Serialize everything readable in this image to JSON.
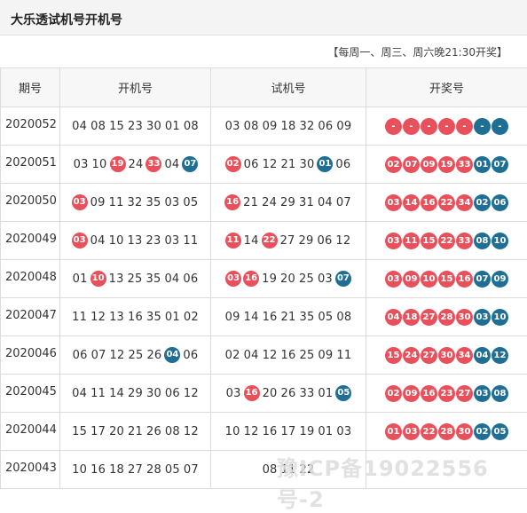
{
  "header": {
    "title": "大乐透试机号开机号"
  },
  "notice": "【每周一、周三、周六晚21:30开奖】",
  "columns": [
    "期号",
    "开机号",
    "试机号",
    "开奖号"
  ],
  "colors": {
    "red": "#e8505b",
    "blue": "#1f6f95"
  },
  "rows": [
    {
      "issue": "2020052",
      "open": [
        {
          "n": "04"
        },
        {
          "n": "08"
        },
        {
          "n": "15"
        },
        {
          "n": "23"
        },
        {
          "n": "30"
        },
        {
          "n": "01"
        },
        {
          "n": "08"
        }
      ],
      "trial": [
        {
          "n": "03"
        },
        {
          "n": "08"
        },
        {
          "n": "09"
        },
        {
          "n": "18"
        },
        {
          "n": "32"
        },
        {
          "n": "06"
        },
        {
          "n": "09"
        }
      ],
      "draw": [
        {
          "n": "-",
          "c": "red"
        },
        {
          "n": "-",
          "c": "red"
        },
        {
          "n": "-",
          "c": "red"
        },
        {
          "n": "-",
          "c": "red"
        },
        {
          "n": "-",
          "c": "red"
        },
        {
          "n": "-",
          "c": "blue"
        },
        {
          "n": "-",
          "c": "blue"
        }
      ]
    },
    {
      "issue": "2020051",
      "open": [
        {
          "n": "03"
        },
        {
          "n": "10"
        },
        {
          "n": "19",
          "c": "red"
        },
        {
          "n": "24"
        },
        {
          "n": "33",
          "c": "red"
        },
        {
          "n": "04"
        },
        {
          "n": "07",
          "c": "blue"
        }
      ],
      "trial": [
        {
          "n": "02",
          "c": "red"
        },
        {
          "n": "06"
        },
        {
          "n": "12"
        },
        {
          "n": "21"
        },
        {
          "n": "30"
        },
        {
          "n": "01",
          "c": "blue"
        },
        {
          "n": "06"
        }
      ],
      "draw": [
        {
          "n": "02",
          "c": "red"
        },
        {
          "n": "07",
          "c": "red"
        },
        {
          "n": "09",
          "c": "red"
        },
        {
          "n": "19",
          "c": "red"
        },
        {
          "n": "33",
          "c": "red"
        },
        {
          "n": "01",
          "c": "blue"
        },
        {
          "n": "07",
          "c": "blue"
        }
      ]
    },
    {
      "issue": "2020050",
      "open": [
        {
          "n": "03",
          "c": "red"
        },
        {
          "n": "09"
        },
        {
          "n": "11"
        },
        {
          "n": "32"
        },
        {
          "n": "35"
        },
        {
          "n": "03"
        },
        {
          "n": "05"
        }
      ],
      "trial": [
        {
          "n": "16",
          "c": "red"
        },
        {
          "n": "21"
        },
        {
          "n": "24"
        },
        {
          "n": "29"
        },
        {
          "n": "31"
        },
        {
          "n": "04"
        },
        {
          "n": "07"
        }
      ],
      "draw": [
        {
          "n": "03",
          "c": "red"
        },
        {
          "n": "14",
          "c": "red"
        },
        {
          "n": "16",
          "c": "red"
        },
        {
          "n": "22",
          "c": "red"
        },
        {
          "n": "34",
          "c": "red"
        },
        {
          "n": "02",
          "c": "blue"
        },
        {
          "n": "06",
          "c": "blue"
        }
      ]
    },
    {
      "issue": "2020049",
      "open": [
        {
          "n": "03",
          "c": "red"
        },
        {
          "n": "04"
        },
        {
          "n": "10"
        },
        {
          "n": "13"
        },
        {
          "n": "23"
        },
        {
          "n": "03"
        },
        {
          "n": "11"
        }
      ],
      "trial": [
        {
          "n": "11",
          "c": "red"
        },
        {
          "n": "14"
        },
        {
          "n": "22",
          "c": "red"
        },
        {
          "n": "27"
        },
        {
          "n": "29"
        },
        {
          "n": "06"
        },
        {
          "n": "12"
        }
      ],
      "draw": [
        {
          "n": "03",
          "c": "red"
        },
        {
          "n": "11",
          "c": "red"
        },
        {
          "n": "15",
          "c": "red"
        },
        {
          "n": "22",
          "c": "red"
        },
        {
          "n": "33",
          "c": "red"
        },
        {
          "n": "08",
          "c": "blue"
        },
        {
          "n": "10",
          "c": "blue"
        }
      ]
    },
    {
      "issue": "2020048",
      "open": [
        {
          "n": "01"
        },
        {
          "n": "10",
          "c": "red"
        },
        {
          "n": "13"
        },
        {
          "n": "25"
        },
        {
          "n": "35"
        },
        {
          "n": "04"
        },
        {
          "n": "06"
        }
      ],
      "trial": [
        {
          "n": "03",
          "c": "red"
        },
        {
          "n": "16",
          "c": "red"
        },
        {
          "n": "19"
        },
        {
          "n": "20"
        },
        {
          "n": "25"
        },
        {
          "n": "03"
        },
        {
          "n": "07",
          "c": "blue"
        }
      ],
      "draw": [
        {
          "n": "03",
          "c": "red"
        },
        {
          "n": "09",
          "c": "red"
        },
        {
          "n": "10",
          "c": "red"
        },
        {
          "n": "15",
          "c": "red"
        },
        {
          "n": "16",
          "c": "red"
        },
        {
          "n": "07",
          "c": "blue"
        },
        {
          "n": "09",
          "c": "blue"
        }
      ]
    },
    {
      "issue": "2020047",
      "open": [
        {
          "n": "11"
        },
        {
          "n": "12"
        },
        {
          "n": "13"
        },
        {
          "n": "16"
        },
        {
          "n": "35"
        },
        {
          "n": "01"
        },
        {
          "n": "02"
        }
      ],
      "trial": [
        {
          "n": "09"
        },
        {
          "n": "14"
        },
        {
          "n": "16"
        },
        {
          "n": "21"
        },
        {
          "n": "35"
        },
        {
          "n": "05"
        },
        {
          "n": "08"
        }
      ],
      "draw": [
        {
          "n": "04",
          "c": "red"
        },
        {
          "n": "18",
          "c": "red"
        },
        {
          "n": "27",
          "c": "red"
        },
        {
          "n": "28",
          "c": "red"
        },
        {
          "n": "30",
          "c": "red"
        },
        {
          "n": "03",
          "c": "blue"
        },
        {
          "n": "10",
          "c": "blue"
        }
      ]
    },
    {
      "issue": "2020046",
      "open": [
        {
          "n": "06"
        },
        {
          "n": "07"
        },
        {
          "n": "12"
        },
        {
          "n": "25"
        },
        {
          "n": "26"
        },
        {
          "n": "04",
          "c": "blue"
        },
        {
          "n": "06"
        }
      ],
      "trial": [
        {
          "n": "02"
        },
        {
          "n": "04"
        },
        {
          "n": "12"
        },
        {
          "n": "16"
        },
        {
          "n": "25"
        },
        {
          "n": "09"
        },
        {
          "n": "11"
        }
      ],
      "draw": [
        {
          "n": "15",
          "c": "red"
        },
        {
          "n": "24",
          "c": "red"
        },
        {
          "n": "27",
          "c": "red"
        },
        {
          "n": "30",
          "c": "red"
        },
        {
          "n": "34",
          "c": "red"
        },
        {
          "n": "04",
          "c": "blue"
        },
        {
          "n": "12",
          "c": "blue"
        }
      ]
    },
    {
      "issue": "2020045",
      "open": [
        {
          "n": "04"
        },
        {
          "n": "11"
        },
        {
          "n": "14"
        },
        {
          "n": "29"
        },
        {
          "n": "30"
        },
        {
          "n": "06"
        },
        {
          "n": "12"
        }
      ],
      "trial": [
        {
          "n": "03"
        },
        {
          "n": "16",
          "c": "red"
        },
        {
          "n": "20"
        },
        {
          "n": "26"
        },
        {
          "n": "33"
        },
        {
          "n": "01"
        },
        {
          "n": "05",
          "c": "blue"
        }
      ],
      "draw": [
        {
          "n": "02",
          "c": "red"
        },
        {
          "n": "09",
          "c": "red"
        },
        {
          "n": "16",
          "c": "red"
        },
        {
          "n": "23",
          "c": "red"
        },
        {
          "n": "27",
          "c": "red"
        },
        {
          "n": "03",
          "c": "blue"
        },
        {
          "n": "08",
          "c": "blue"
        }
      ]
    },
    {
      "issue": "2020044",
      "open": [
        {
          "n": "15"
        },
        {
          "n": "17"
        },
        {
          "n": "20"
        },
        {
          "n": "21"
        },
        {
          "n": "26"
        },
        {
          "n": "08"
        },
        {
          "n": "12"
        }
      ],
      "trial": [
        {
          "n": "10"
        },
        {
          "n": "12"
        },
        {
          "n": "16"
        },
        {
          "n": "17"
        },
        {
          "n": "19"
        },
        {
          "n": "01"
        },
        {
          "n": "03"
        }
      ],
      "draw": [
        {
          "n": "01",
          "c": "red"
        },
        {
          "n": "03",
          "c": "red"
        },
        {
          "n": "22",
          "c": "red"
        },
        {
          "n": "28",
          "c": "red"
        },
        {
          "n": "30",
          "c": "red"
        },
        {
          "n": "02",
          "c": "blue"
        },
        {
          "n": "05",
          "c": "blue"
        }
      ]
    },
    {
      "issue": "2020043",
      "open": [
        {
          "n": "10"
        },
        {
          "n": "16"
        },
        {
          "n": "18"
        },
        {
          "n": "27"
        },
        {
          "n": "28"
        },
        {
          "n": "05"
        },
        {
          "n": "07"
        }
      ],
      "trial": [
        {
          "n": "08"
        },
        {
          "n": "11"
        },
        {
          "n": "22"
        }
      ],
      "draw": []
    }
  ],
  "watermark": "豫ICP备19022556号-2"
}
